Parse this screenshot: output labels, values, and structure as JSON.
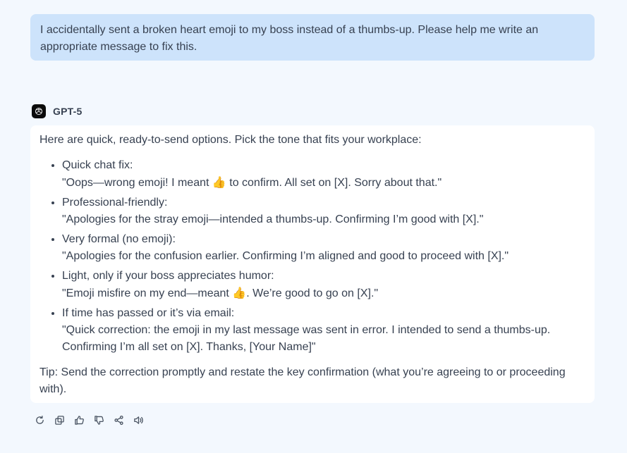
{
  "user_message": "I accidentally sent a broken heart emoji to my boss instead of a thumbs-up. Please help me write an appropriate message to fix this.",
  "model": {
    "name": "GPT-5",
    "logo_icon": "openai-logo-icon"
  },
  "response": {
    "intro": "Here are quick, ready-to-send options. Pick the tone that fits your workplace:",
    "options": [
      {
        "label": "Quick chat fix:",
        "text_before": "\"Oops—wrong emoji! I meant ",
        "emoji": "👍",
        "text_after": " to confirm. All set on [X]. Sorry about that.\""
      },
      {
        "label": "Professional-friendly:",
        "text": "\"Apologies for the stray emoji—intended a thumbs-up. Confirming I’m good with [X].\""
      },
      {
        "label": "Very formal (no emoji):",
        "text": "\"Apologies for the confusion earlier. Confirming I’m aligned and good to proceed with [X].\""
      },
      {
        "label": "Light, only if your boss appreciates humor:",
        "text_before": "\"Emoji misfire on my end—meant ",
        "emoji": "👍",
        "text_after": ". We’re good to go on [X].\""
      },
      {
        "label": "If time has passed or it’s via email:",
        "text": "\"Quick correction: the emoji in my last message was sent in error. I intended to send a thumbs-up. Confirming I’m all set on [X]. Thanks, [Your Name]\""
      }
    ],
    "tip": "Tip: Send the correction promptly and restate the key confirmation (what you’re agreeing to or proceeding with)."
  },
  "actions": [
    {
      "name": "regenerate-icon"
    },
    {
      "name": "copy-icon"
    },
    {
      "name": "thumbs-up-icon"
    },
    {
      "name": "thumbs-down-icon"
    },
    {
      "name": "share-icon"
    },
    {
      "name": "speaker-icon"
    }
  ]
}
